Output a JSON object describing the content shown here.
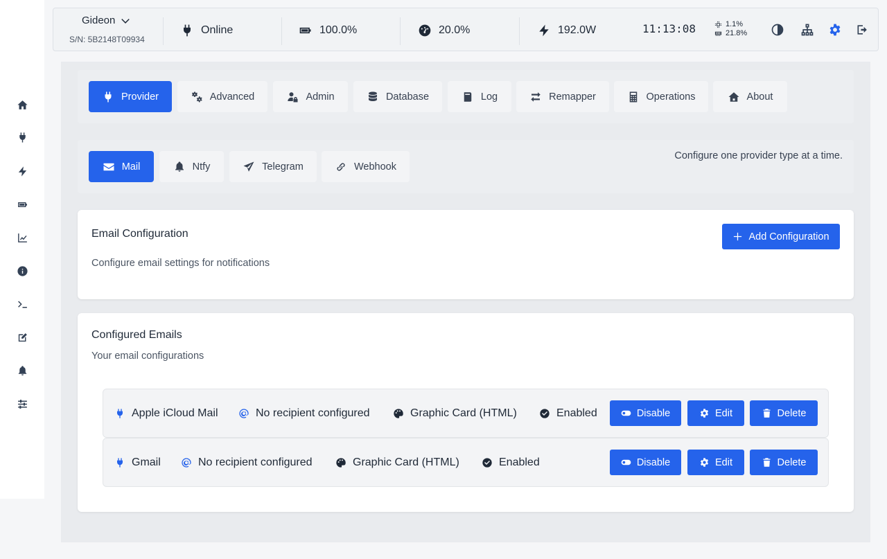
{
  "device": {
    "name": "Gideon",
    "serial": "S/N: 5B2148T09934"
  },
  "status": {
    "connection": "Online",
    "battery": "100.0%",
    "load": "20.0%",
    "power": "192.0W",
    "time": "11:13:08",
    "cpu": "1.1%",
    "memory": "21.8%"
  },
  "main_tabs": [
    {
      "label": "Provider",
      "icon": "plug-icon",
      "active": true
    },
    {
      "label": "Advanced",
      "icon": "gears-icon"
    },
    {
      "label": "Admin",
      "icon": "user-lock-icon"
    },
    {
      "label": "Database",
      "icon": "database-icon"
    },
    {
      "label": "Log",
      "icon": "log-icon"
    },
    {
      "label": "Remapper",
      "icon": "arrows-exchange-icon"
    },
    {
      "label": "Operations",
      "icon": "calculator-icon"
    },
    {
      "label": "About",
      "icon": "house-icon"
    }
  ],
  "provider_tabs": [
    {
      "label": "Mail",
      "icon": "envelope-icon",
      "active": true
    },
    {
      "label": "Ntfy",
      "icon": "bell-icon"
    },
    {
      "label": "Telegram",
      "icon": "paper-plane-icon"
    },
    {
      "label": "Webhook",
      "icon": "link-icon"
    }
  ],
  "provider_note": "Configure one provider type at a time.",
  "email_config": {
    "title": "Email Configuration",
    "description": "Configure email settings for notifications",
    "add_button": "Add Configuration"
  },
  "configured": {
    "title": "Configured Emails",
    "description": "Your email configurations",
    "rows": [
      {
        "name": "Apple iCloud Mail",
        "recipient": "No recipient configured",
        "format": "Graphic Card (HTML)",
        "state": "Enabled",
        "disable": "Disable",
        "edit": "Edit",
        "delete": "Delete"
      },
      {
        "name": "Gmail",
        "recipient": "No recipient configured",
        "format": "Graphic Card (HTML)",
        "state": "Enabled",
        "disable": "Disable",
        "edit": "Edit",
        "delete": "Delete"
      }
    ]
  },
  "colors": {
    "accent": "#2563eb",
    "panel": "#e9ebee",
    "text": "#1f2937"
  }
}
